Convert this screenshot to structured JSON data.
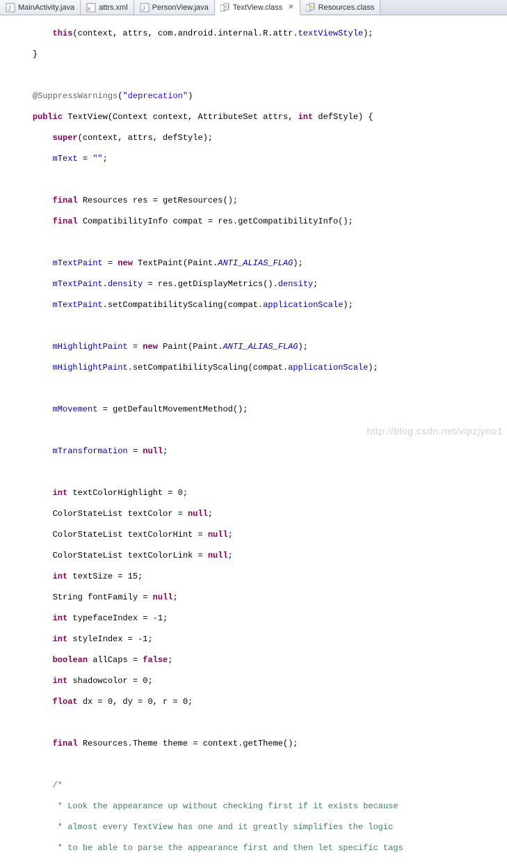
{
  "tabs": [
    {
      "label": "MainActivity.java",
      "icon": "java-file-icon",
      "active": false,
      "closable": false
    },
    {
      "label": "attrs.xml",
      "icon": "xml-file-icon",
      "active": false,
      "closable": false
    },
    {
      "label": "PersonView.java",
      "icon": "java-file-icon",
      "active": false,
      "closable": false
    },
    {
      "label": "TextView.class",
      "icon": "class-file-icon",
      "active": true,
      "closable": true
    },
    {
      "label": "Resources.class",
      "icon": "class-file-icon",
      "active": false,
      "closable": false
    }
  ],
  "code": {
    "t": {
      "kw_this": "this",
      "kw_public": "public",
      "kw_super": "super",
      "kw_final": "final",
      "kw_new": "new",
      "kw_null": "null",
      "kw_int": "int",
      "kw_float": "float",
      "kw_boolean": "boolean",
      "kw_false": "false",
      "ann": "@SuppressWarnings",
      "str_dep": "\"deprecation\"",
      "str_empty": "\"\"",
      "s_antialias": "ANTI_ALIAS_FLAG",
      "fld_mText": "mText",
      "fld_mTextPaint": "mTextPaint",
      "fld_density": "density",
      "fld_applicationScale": "applicationScale",
      "fld_mHighlightPaint": "mHighlightPaint",
      "fld_mMovement": "mMovement",
      "fld_mTransformation": "mTransformation",
      "fld_textViewStyle": "textViewStyle"
    },
    "l1": "(context, attrs, com.android.internal.R.attr.",
    "l1b": ");",
    "l2": "}",
    "l3": "(",
    "l3b": ")",
    "l4a": " TextView(Context context, AttributeSet attrs, ",
    "l4b": " defStyle) {",
    "l5": "(context, attrs, defStyle);",
    "l6a": " = ",
    "l6b": ";",
    "l8a": " Resources res = getResources();",
    "l9a": " CompatibilityInfo compat = res.getCompatibilityInfo();",
    "l11a": " = ",
    "l11b": " TextPaint(Paint.",
    "l11c": ");",
    "l12a": ".",
    "l12b": " = res.getDisplayMetrics().",
    "l12c": ";",
    "l13a": ".setCompatibilityScaling(compat.",
    "l13b": ");",
    "l15a": " = ",
    "l15b": " Paint(Paint.",
    "l15c": ");",
    "l16a": ".setCompatibilityScaling(compat.",
    "l16b": ");",
    "l18a": " = getDefaultMovementMethod();",
    "l20a": " = ",
    "l20b": ";",
    "l22": " textColorHighlight = 0;",
    "l23": "ColorStateList textColor = ",
    "l24": "ColorStateList textColorHint = ",
    "l25": "ColorStateList textColorLink = ",
    "l26": " textSize = 15;",
    "l27": "String fontFamily = ",
    "l28": " typefaceIndex = -1;",
    "l29": " styleIndex = -1;",
    "l30": " allCaps = ",
    "l31": " shadowcolor = 0;",
    "l32": " dx = 0, dy = 0, r = 0;",
    "l34": " Resources.Theme theme = context.getTheme();",
    "c1": "/*",
    "c2": " * Look the appearance up without checking first if it exists because",
    "c3": " * almost every TextView has one and it greatly simplifies the logic",
    "c4": " * to be able to parse the appearance first and then let specific tags"
  },
  "watermark": "http://blog.csdn.net/vipzjyno1"
}
